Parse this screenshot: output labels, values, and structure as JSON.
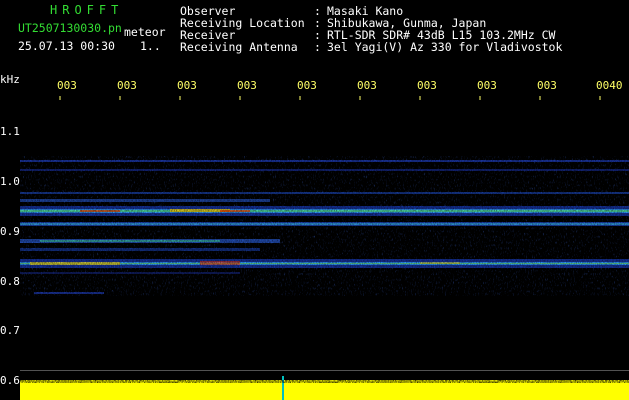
{
  "header": {
    "app_title": "HROFFT",
    "filename": "UT2507130030.pn",
    "tag": "meteor",
    "datetime": "25.07.13 00:30",
    "counter": "1..",
    "info": [
      {
        "label": "Observer",
        "value": "Masaki Kano"
      },
      {
        "label": "Receiving Location",
        "value": "Shibukawa, Gunma, Japan"
      },
      {
        "label": "Receiver",
        "value": "RTL-SDR SDR# 43dB L15 103.2MHz CW"
      },
      {
        "label": "Receiving Antenna",
        "value": "3el Yagi(V) Az 330 for Vladivostok"
      }
    ]
  },
  "axis": {
    "y_label": "kHz",
    "y_ticks": [
      "1.1",
      "1.0",
      "0.9",
      "0.8",
      "0.7",
      "0.6"
    ],
    "x_ticks": [
      "003",
      "003",
      "003",
      "003",
      "003",
      "003",
      "003",
      "003",
      "003",
      "0040"
    ]
  },
  "colors": {
    "background": "#000000",
    "text_white": "#ffffff",
    "text_green": "#33dd33",
    "tick_yellow": "#ffff66",
    "signal_bar": "#ffff00",
    "band_low": "#1020a0",
    "band_mid": "#20c0ff",
    "band_high": "#ffcc00",
    "band_peak": "#ff3000"
  }
}
